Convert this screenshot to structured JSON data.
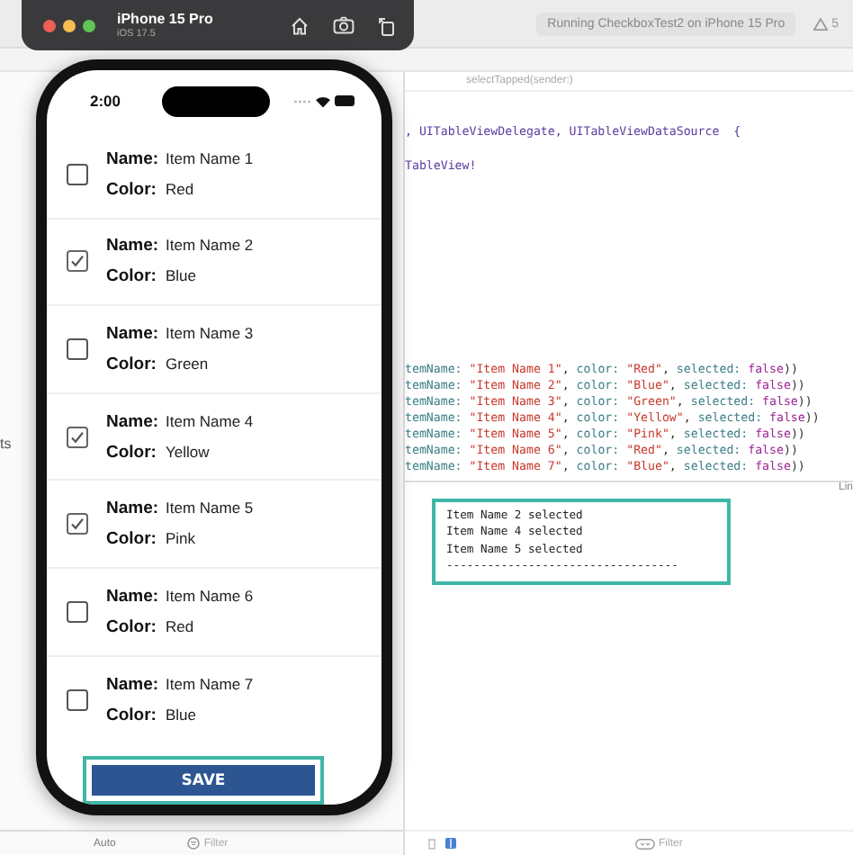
{
  "xcode": {
    "run_status": "Running CheckboxTest2 on iPhone 15 Pro",
    "warning_count": "5",
    "breadcrumb": "selectTapped(sender:)",
    "navigator_text": "ts",
    "code_lines": [
      [
        {
          "kind": "type",
          "text": ", UITableViewDelegate, UITableViewDataSource  {"
        }
      ],
      [
        {
          "kind": "type",
          "text": "TableView!"
        }
      ],
      [
        {
          "kind": "label",
          "text": "temName: "
        },
        {
          "kind": "string",
          "text": "\"Item Name 1\""
        },
        {
          "kind": "plain",
          "text": ", "
        },
        {
          "kind": "label",
          "text": "color: "
        },
        {
          "kind": "string",
          "text": "\"Red\""
        },
        {
          "kind": "plain",
          "text": ", "
        },
        {
          "kind": "label",
          "text": "selected: "
        },
        {
          "kind": "keyword",
          "text": "false"
        },
        {
          "kind": "plain",
          "text": "))"
        }
      ],
      [
        {
          "kind": "label",
          "text": "temName: "
        },
        {
          "kind": "string",
          "text": "\"Item Name 2\""
        },
        {
          "kind": "plain",
          "text": ", "
        },
        {
          "kind": "label",
          "text": "color: "
        },
        {
          "kind": "string",
          "text": "\"Blue\""
        },
        {
          "kind": "plain",
          "text": ", "
        },
        {
          "kind": "label",
          "text": "selected: "
        },
        {
          "kind": "keyword",
          "text": "false"
        },
        {
          "kind": "plain",
          "text": "))"
        }
      ],
      [
        {
          "kind": "label",
          "text": "temName: "
        },
        {
          "kind": "string",
          "text": "\"Item Name 3\""
        },
        {
          "kind": "plain",
          "text": ", "
        },
        {
          "kind": "label",
          "text": "color: "
        },
        {
          "kind": "string",
          "text": "\"Green\""
        },
        {
          "kind": "plain",
          "text": ", "
        },
        {
          "kind": "label",
          "text": "selected: "
        },
        {
          "kind": "keyword",
          "text": "false"
        },
        {
          "kind": "plain",
          "text": "))"
        }
      ],
      [
        {
          "kind": "label",
          "text": "temName: "
        },
        {
          "kind": "string",
          "text": "\"Item Name 4\""
        },
        {
          "kind": "plain",
          "text": ", "
        },
        {
          "kind": "label",
          "text": "color: "
        },
        {
          "kind": "string",
          "text": "\"Yellow\""
        },
        {
          "kind": "plain",
          "text": ", "
        },
        {
          "kind": "label",
          "text": "selected: "
        },
        {
          "kind": "keyword",
          "text": "false"
        },
        {
          "kind": "plain",
          "text": "))"
        }
      ],
      [
        {
          "kind": "label",
          "text": "temName: "
        },
        {
          "kind": "string",
          "text": "\"Item Name 5\""
        },
        {
          "kind": "plain",
          "text": ", "
        },
        {
          "kind": "label",
          "text": "color: "
        },
        {
          "kind": "string",
          "text": "\"Pink\""
        },
        {
          "kind": "plain",
          "text": ", "
        },
        {
          "kind": "label",
          "text": "selected: "
        },
        {
          "kind": "keyword",
          "text": "false"
        },
        {
          "kind": "plain",
          "text": "))"
        }
      ],
      [
        {
          "kind": "label",
          "text": "temName: "
        },
        {
          "kind": "string",
          "text": "\"Item Name 6\""
        },
        {
          "kind": "plain",
          "text": ", "
        },
        {
          "kind": "label",
          "text": "color: "
        },
        {
          "kind": "string",
          "text": "\"Red\""
        },
        {
          "kind": "plain",
          "text": ", "
        },
        {
          "kind": "label",
          "text": "selected: "
        },
        {
          "kind": "keyword",
          "text": "false"
        },
        {
          "kind": "plain",
          "text": "))"
        }
      ],
      [
        {
          "kind": "label",
          "text": "temName: "
        },
        {
          "kind": "string",
          "text": "\"Item Name 7\""
        },
        {
          "kind": "plain",
          "text": ", "
        },
        {
          "kind": "label",
          "text": "color: "
        },
        {
          "kind": "string",
          "text": "\"Blue\""
        },
        {
          "kind": "plain",
          "text": ", "
        },
        {
          "kind": "label",
          "text": "selected: "
        },
        {
          "kind": "keyword",
          "text": "false"
        },
        {
          "kind": "plain",
          "text": "))"
        }
      ]
    ],
    "console_header": "Lin",
    "console_lines": [
      "Item Name 2 selected",
      "Item Name 4 selected",
      "Item Name 5 selected",
      "----------------------------------"
    ],
    "bottom_left": {
      "scheme": "Auto",
      "filter": "Filter"
    },
    "console_filter": "Filter"
  },
  "simulator": {
    "title": "iPhone 15 Pro",
    "subtitle": "iOS 17.5"
  },
  "phone": {
    "time": "2:00",
    "items": [
      {
        "name_label": "Name:",
        "name": "Item Name 1",
        "color_label": "Color:",
        "color_name": "Red",
        "checked": false
      },
      {
        "name_label": "Name:",
        "name": "Item Name 2",
        "color_label": "Color:",
        "color_name": "Blue",
        "checked": true
      },
      {
        "name_label": "Name:",
        "name": "Item Name 3",
        "color_label": "Color:",
        "color_name": "Green",
        "checked": false
      },
      {
        "name_label": "Name:",
        "name": "Item Name 4",
        "color_label": "Color:",
        "color_name": "Yellow",
        "checked": true
      },
      {
        "name_label": "Name:",
        "name": "Item Name 5",
        "color_label": "Color:",
        "color_name": "Pink",
        "checked": true
      },
      {
        "name_label": "Name:",
        "name": "Item Name 6",
        "color_label": "Color:",
        "color_name": "Red",
        "checked": false
      },
      {
        "name_label": "Name:",
        "name": "Item Name 7",
        "color_label": "Color:",
        "color_name": "Blue",
        "checked": false
      }
    ],
    "save_button": "SAVE"
  }
}
